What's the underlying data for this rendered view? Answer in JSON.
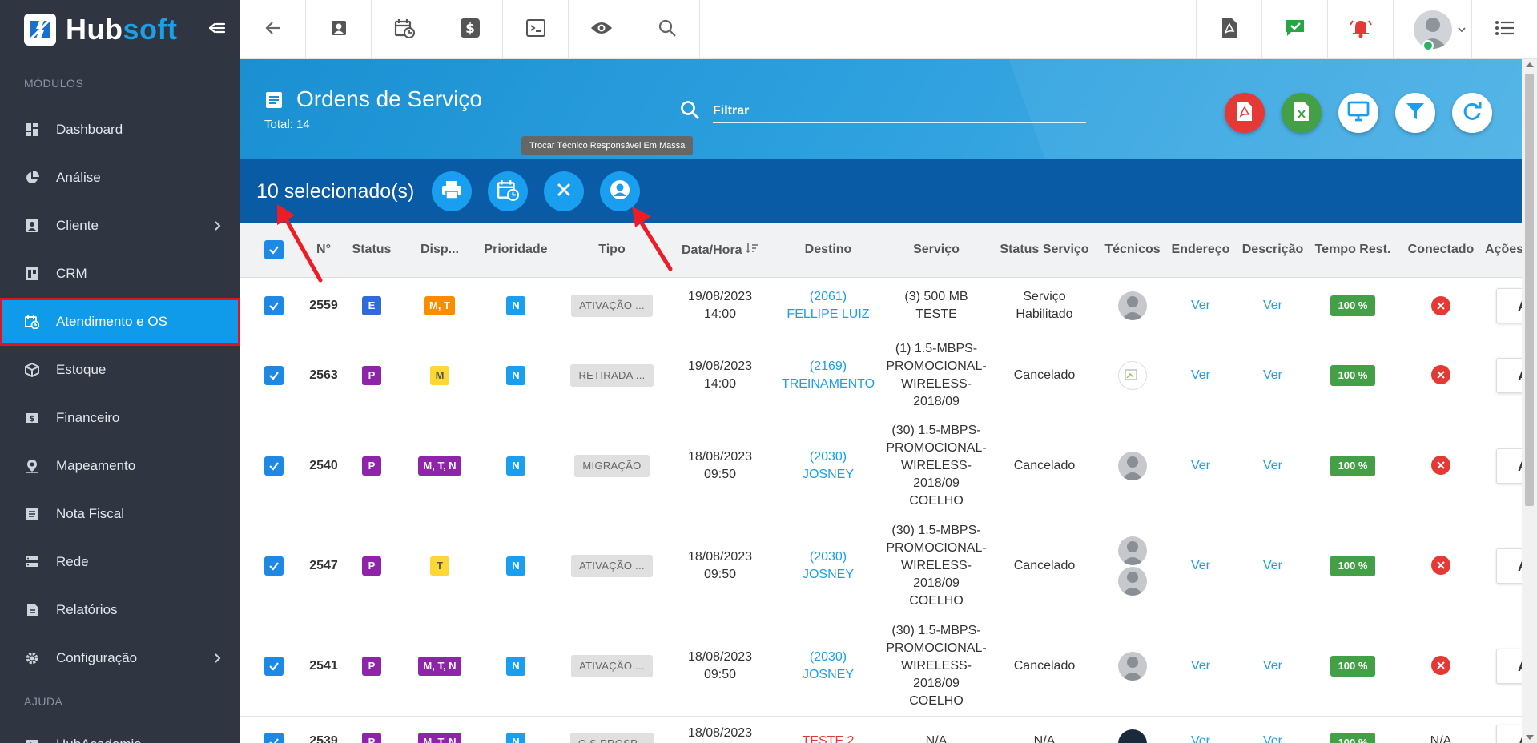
{
  "brand": {
    "hub": "Hub",
    "soft": "soft"
  },
  "sidebar": {
    "section_modules": "MÓDULOS",
    "section_help": "AJUDA",
    "items": [
      {
        "label": "Dashboard",
        "icon": "dashboard-icon"
      },
      {
        "label": "Análise",
        "icon": "pie-chart-icon"
      },
      {
        "label": "Cliente",
        "icon": "contact-card-icon",
        "has_children": true
      },
      {
        "label": "CRM",
        "icon": "board-icon"
      },
      {
        "label": "Atendimento e OS",
        "icon": "calendar-clock-icon",
        "active": true
      },
      {
        "label": "Estoque",
        "icon": "box-icon"
      },
      {
        "label": "Financeiro",
        "icon": "money-icon"
      },
      {
        "label": "Mapeamento",
        "icon": "map-pin-icon"
      },
      {
        "label": "Nota Fiscal",
        "icon": "document-icon"
      },
      {
        "label": "Rede",
        "icon": "server-icon"
      },
      {
        "label": "Relatórios",
        "icon": "report-icon"
      },
      {
        "label": "Configuração",
        "icon": "gear-icon",
        "has_children": true
      }
    ],
    "help_items": [
      {
        "label": "HubAcademia",
        "icon": "play-icon"
      }
    ]
  },
  "header": {
    "title": "Ordens de Serviço",
    "total": "Total: 14",
    "filter_placeholder": "Filtrar"
  },
  "tooltip": "Trocar Técnico Responsável Em Massa",
  "selection": {
    "count_label": "10 selecionado(s)"
  },
  "table": {
    "columns": [
      "N°",
      "Status",
      "Disp...",
      "Prioridade",
      "Tipo",
      "Data/Hora",
      "Destino",
      "Serviço",
      "Status Serviço",
      "Técnicos",
      "Endereço",
      "Descrição",
      "Tempo Rest.",
      "Conectado",
      "Ações"
    ],
    "rows": [
      {
        "num": "2559",
        "status": "E",
        "disp": "M, T",
        "prioridade": "N",
        "tipo": "ATIVAÇÃO ...",
        "data": "19/08/2023",
        "hora": "14:00",
        "destino_code": "(2061)",
        "destino_name": "FELLIPE LUIZ",
        "servico": [
          "(3) 500 MB",
          "TESTE"
        ],
        "status_servico": [
          "Serviço",
          "Habilitado"
        ],
        "endereco": "Ver",
        "descricao": "Ver",
        "tempo": "100 %",
        "acoes": "AÇÕ"
      },
      {
        "num": "2563",
        "status": "P",
        "disp": "M",
        "prioridade": "N",
        "tipo": "RETIRADA ...",
        "data": "19/08/2023",
        "hora": "14:00",
        "destino_code": "(2169)",
        "destino_name": "TREINAMENTO",
        "servico": [
          "(1) 1.5-MBPS-",
          "PROMOCIONAL-",
          "WIRELESS-",
          "2018/09"
        ],
        "status_servico": [
          "Cancelado"
        ],
        "endereco": "Ver",
        "descricao": "Ver",
        "tempo": "100 %",
        "acoes": "AÇÕ"
      },
      {
        "num": "2540",
        "status": "P",
        "disp": "M, T, N",
        "prioridade": "N",
        "tipo": "MIGRAÇÃO",
        "data": "18/08/2023",
        "hora": "09:50",
        "destino_code": "(2030)",
        "destino_name": "JOSNEY",
        "servico": [
          "(30) 1.5-MBPS-",
          "PROMOCIONAL-",
          "WIRELESS-",
          "2018/09",
          "COELHO"
        ],
        "status_servico": [
          "Cancelado"
        ],
        "endereco": "Ver",
        "descricao": "Ver",
        "tempo": "100 %",
        "acoes": "AÇÕ"
      },
      {
        "num": "2547",
        "status": "P",
        "disp": "T",
        "prioridade": "N",
        "tipo": "ATIVAÇÃO ...",
        "data": "18/08/2023",
        "hora": "09:50",
        "destino_code": "(2030)",
        "destino_name": "JOSNEY",
        "servico": [
          "(30) 1.5-MBPS-",
          "PROMOCIONAL-",
          "WIRELESS-",
          "2018/09",
          "COELHO"
        ],
        "status_servico": [
          "Cancelado"
        ],
        "endereco": "Ver",
        "descricao": "Ver",
        "tempo": "100 %",
        "acoes": "AÇÕ"
      },
      {
        "num": "2541",
        "status": "P",
        "disp": "M, T, N",
        "prioridade": "N",
        "tipo": "ATIVAÇÃO ...",
        "data": "18/08/2023",
        "hora": "09:50",
        "destino_code": "(2030)",
        "destino_name": "JOSNEY",
        "servico": [
          "(30) 1.5-MBPS-",
          "PROMOCIONAL-",
          "WIRELESS-",
          "2018/09",
          "COELHO"
        ],
        "status_servico": [
          "Cancelado"
        ],
        "endereco": "Ver",
        "descricao": "Ver",
        "tempo": "100 %",
        "acoes": "AÇÕ"
      },
      {
        "num": "2539",
        "status": "P",
        "disp": "M, T, N",
        "prioridade": "N",
        "tipo": "O.S PROSP...",
        "data": "18/08/2023",
        "hora": "",
        "destino_code": "",
        "destino_name": "TESTE 2",
        "servico": [
          "N/A"
        ],
        "status_servico": [
          "N/A"
        ],
        "endereco": "Ver",
        "descricao": "Ver",
        "tempo": "100 %",
        "conectado": "N/A",
        "acoes": "AÇÕ"
      }
    ]
  }
}
